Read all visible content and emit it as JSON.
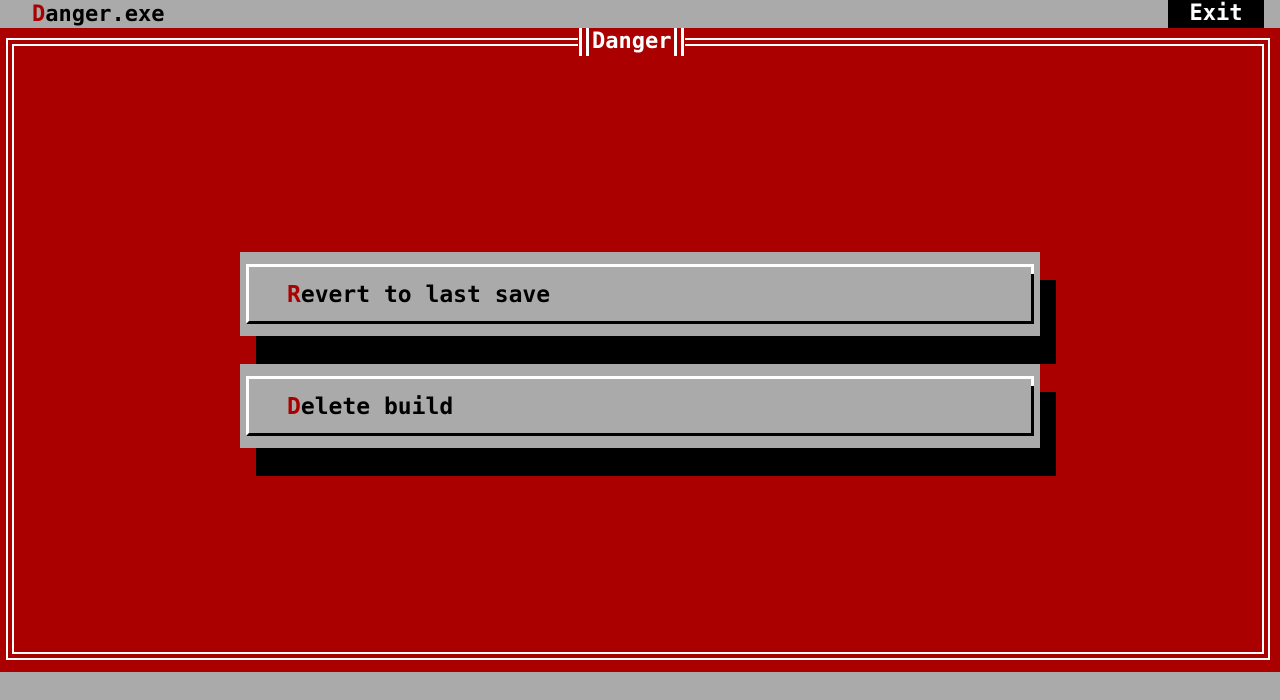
{
  "app": {
    "title_hotkey": "D",
    "title_rest": "anger.exe"
  },
  "menubar": {
    "exit_label": "Exit"
  },
  "dialog": {
    "title": "Danger",
    "buttons": [
      {
        "hotkey": "R",
        "label_rest": "evert to last save"
      },
      {
        "hotkey": "D",
        "label_rest": "elete build"
      }
    ]
  },
  "colors": {
    "dialog_background": "#aa0000",
    "chrome_gray": "#aaaaaa",
    "hotkey_red": "#aa0000",
    "frame_white": "#ffffff",
    "shadow_black": "#000000"
  }
}
